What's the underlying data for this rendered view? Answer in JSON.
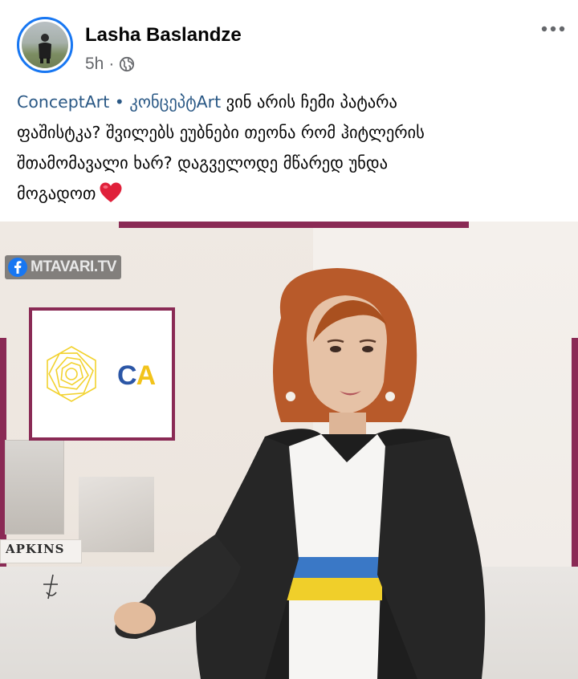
{
  "post": {
    "author": "Lasha Baslandze",
    "time": "5h",
    "separator": "·",
    "text_lines": [
      {
        "links": "ConceptArt • კონცეპტArt",
        "rest": " ვინ არის ჩემი პატარა"
      },
      "ფაშისტკა? შვილებს ეუბნები თეონა რომ ჰიტლერის",
      "შთამომავალი ხარ? დაგველოდე მწარედ უნდა",
      "მოგადოთ"
    ]
  },
  "image": {
    "channel_badge": "MTAVARI.TV",
    "logo_text_c": "C",
    "logo_text_a": "A",
    "shelf_label": "APKINS"
  },
  "icons": {
    "globe": "globe-icon",
    "more": "more-options-icon",
    "heart": "heart-icon",
    "facebook": "facebook-icon"
  },
  "colors": {
    "link": "#2a5885",
    "meta": "#65676b",
    "frame": "#8a2a55",
    "avatar_ring": "#1877f2"
  }
}
